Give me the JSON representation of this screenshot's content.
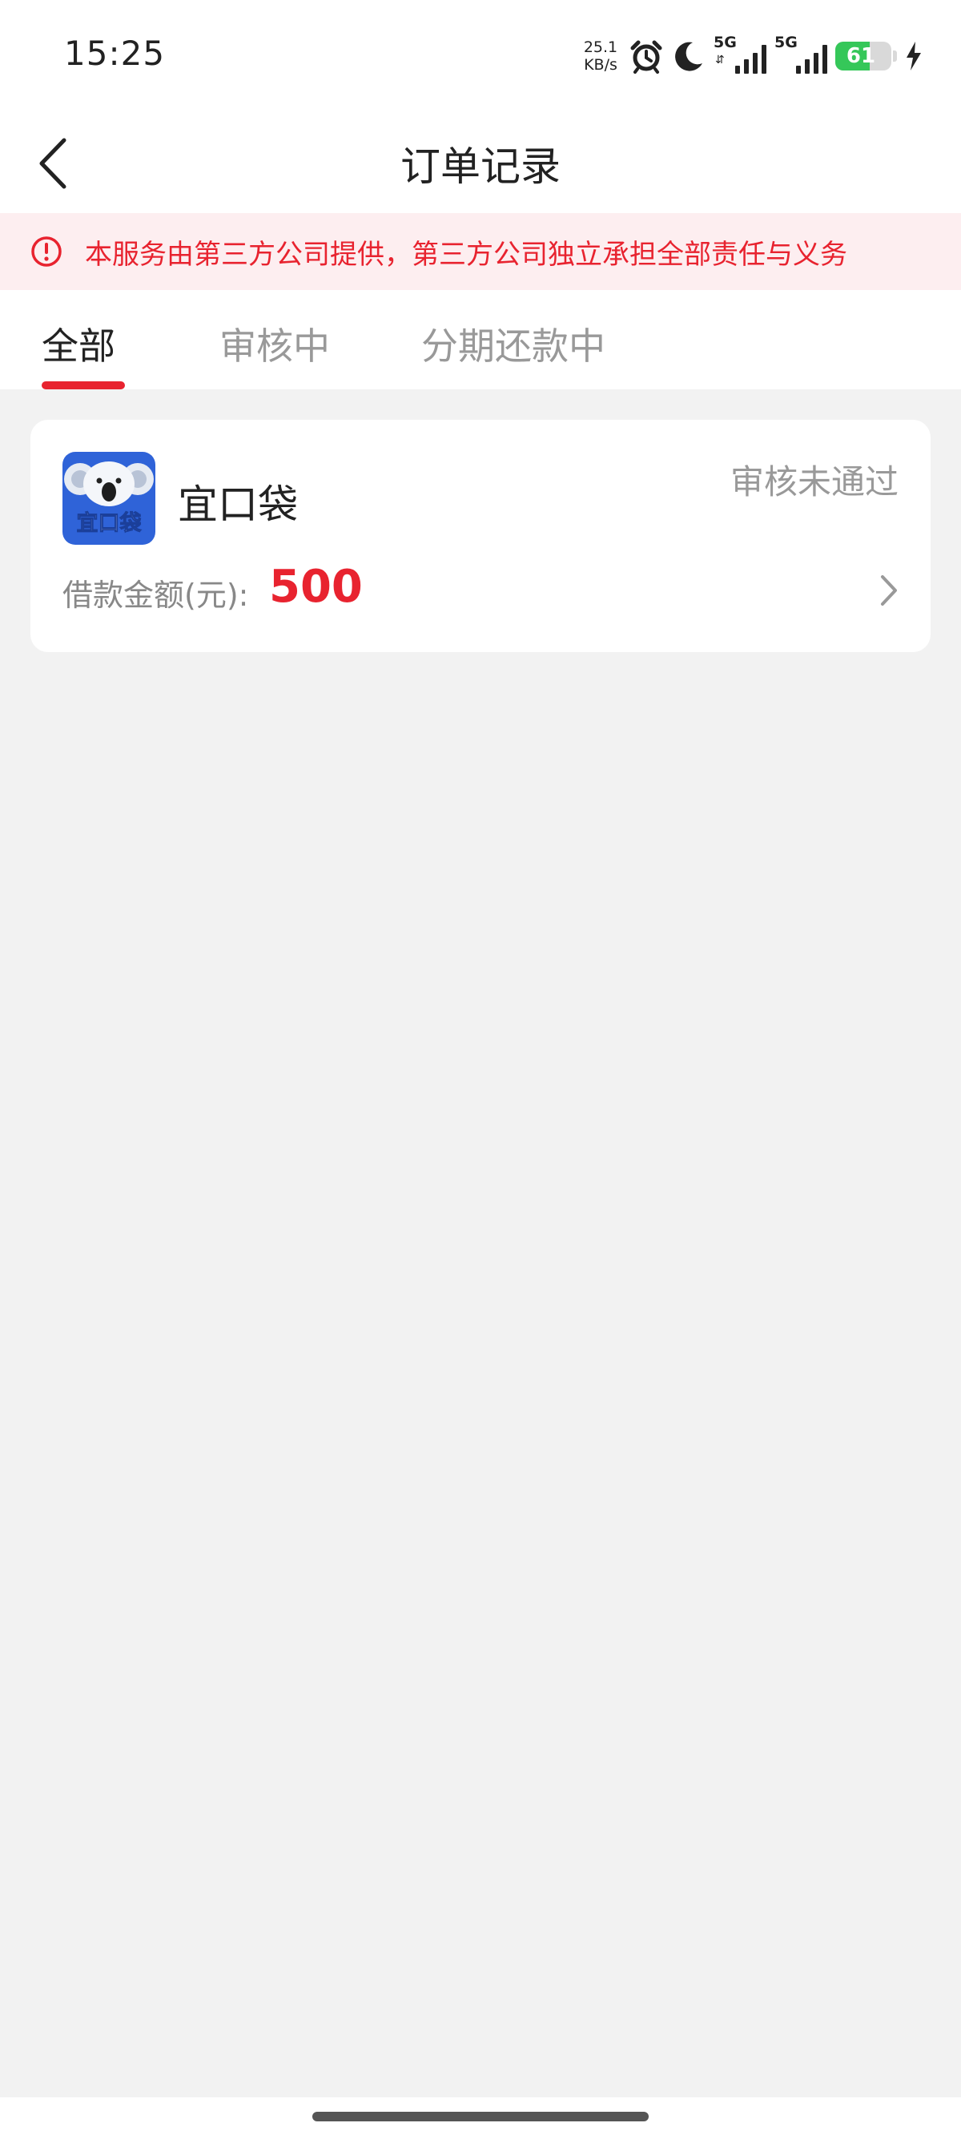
{
  "status_bar": {
    "time": "15:25",
    "net_speed_value": "25.1",
    "net_speed_unit": "KB/s",
    "signal1_label": "5G",
    "signal2_label": "5G",
    "battery_level": "61"
  },
  "header": {
    "title": "订单记录"
  },
  "notice": {
    "text": "本服务由第三方公司提供，第三方公司独立承担全部责任与义务"
  },
  "tabs": [
    {
      "label": "全部",
      "active": true
    },
    {
      "label": "审核中",
      "active": false
    },
    {
      "label": "分期还款中",
      "active": false
    }
  ],
  "orders": [
    {
      "name": "宜口袋",
      "logo_text": "宜口袋",
      "status": "审核未通过",
      "amount_label": "借款金额(元):",
      "amount": "500"
    }
  ],
  "colors": {
    "accent": "#e8232f",
    "notice_bg": "#fdeef0",
    "logo_blue": "#2f63d8",
    "battery_green": "#35c759"
  }
}
